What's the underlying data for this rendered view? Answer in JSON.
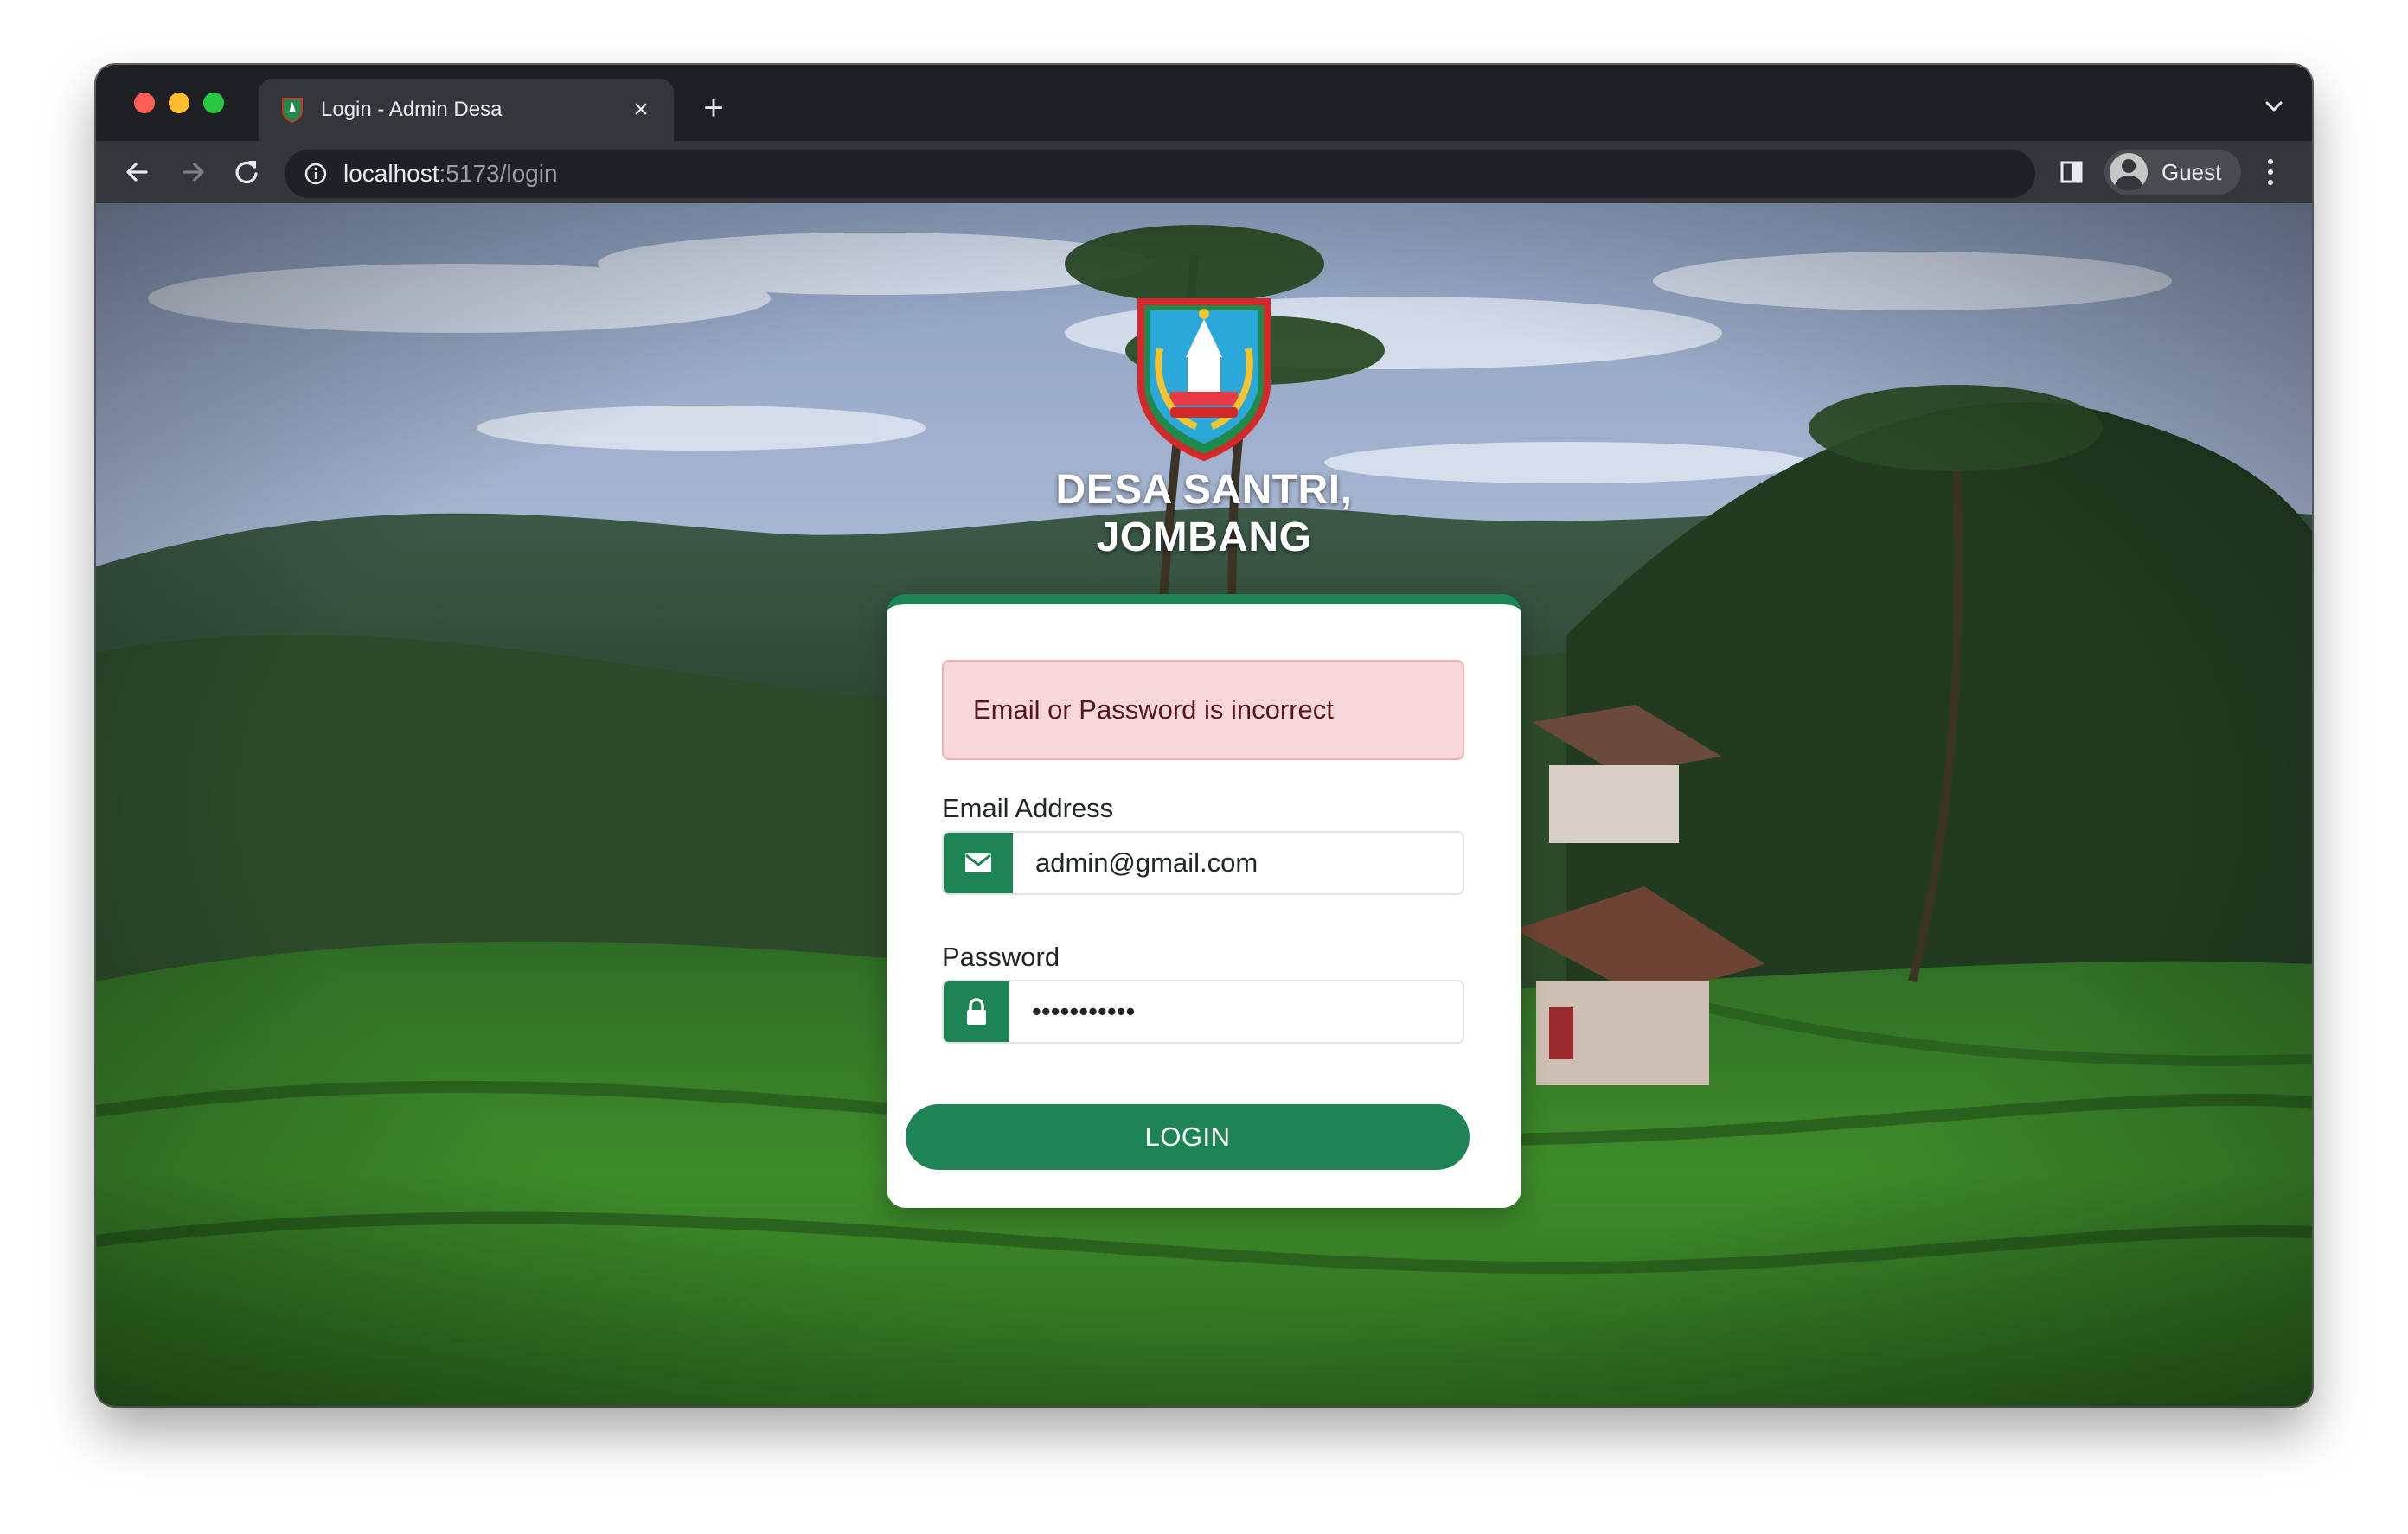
{
  "browser": {
    "tab_title": "Login - Admin Desa",
    "tab_close": "×",
    "new_tab": "+",
    "url_host": "localhost",
    "url_rest": ":5173/login",
    "profile_label": "Guest"
  },
  "page": {
    "brand_title": "DESA SANTRI, JOMBANG",
    "error_message": "Email or Password is incorrect",
    "email_label": "Email Address",
    "email_value": "admin@gmail.com",
    "password_label": "Password",
    "password_value": "admin123456",
    "login_button": "LOGIN"
  },
  "colors": {
    "primary_green": "#1c8455",
    "alert_bg": "#f8d7da",
    "alert_text": "#58151c",
    "browser_chrome": "#35363a"
  },
  "icons": [
    "favicon-emblem-icon",
    "back-icon",
    "forward-icon",
    "reload-icon",
    "info-icon",
    "side-panel-icon",
    "avatar-icon",
    "kebab-menu-icon",
    "tab-search-chevron-icon",
    "envelope-icon",
    "lock-icon"
  ]
}
